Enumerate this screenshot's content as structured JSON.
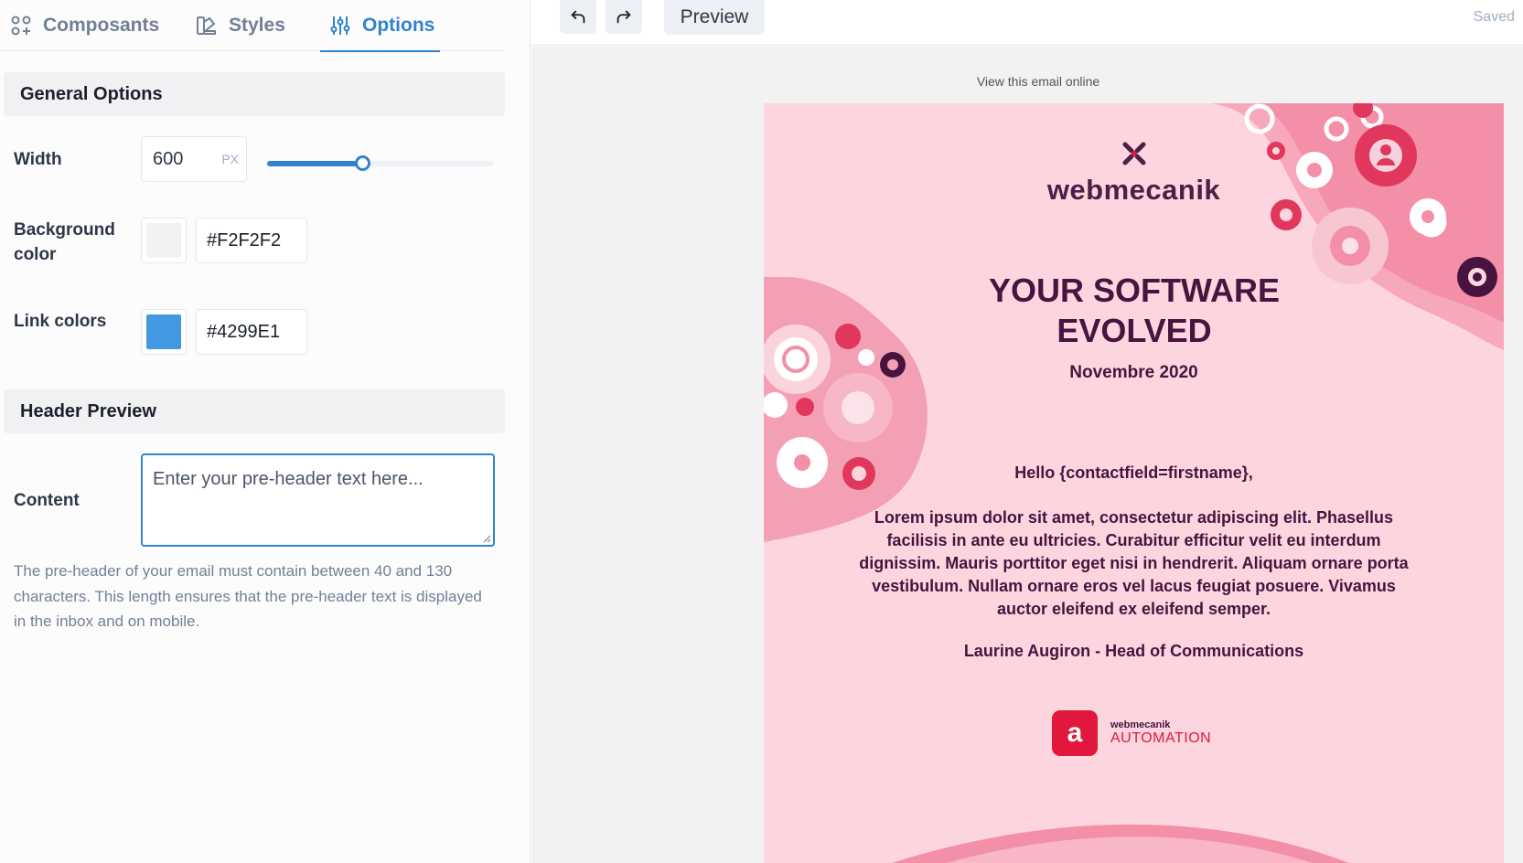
{
  "tabs": [
    {
      "label": "Composants",
      "icon": "components-icon"
    },
    {
      "label": "Styles",
      "icon": "styles-icon"
    },
    {
      "label": "Options",
      "icon": "sliders-icon",
      "active": true
    }
  ],
  "general_options": {
    "title": "General Options",
    "width": {
      "label": "Width",
      "value": "600",
      "unit": "PX",
      "slider_fraction": 0.42
    },
    "background": {
      "label": "Background color",
      "value": "#F2F2F2",
      "swatch": "#F2F2F2"
    },
    "links": {
      "label": "Link colors",
      "value": "#4299E1",
      "swatch": "#4299E1"
    }
  },
  "header_preview": {
    "title": "Header Preview",
    "content_label": "Content",
    "placeholder": "Enter your pre-header text here...",
    "helper": "The pre-header of your email must contain between 40 and 130 characters. This length ensures that the pre-header text is displayed in the inbox and on mobile."
  },
  "toolbar": {
    "undo_icon": "undo-icon",
    "redo_icon": "redo-icon",
    "preview_label": "Preview",
    "status": "Saved"
  },
  "email": {
    "view_online": "View this email online",
    "brand": "webmecanik",
    "headline": "YOUR SOFTWARE EVOLVED",
    "date": "Novembre 2020",
    "greeting": "Hello {contactfield=firstname},",
    "body": "Lorem ipsum dolor sit amet, consectetur adipiscing elit. Phasellus facilisis in ante eu ultricies. Curabitur efficitur velit eu interdum dignissim. Mauris porttitor eget nisi in hendrerit. Aliquam ornare porta vestibulum. Nullam ornare eros vel lacus feugiat posuere. Vivamus auctor eleifend ex eleifend semper.",
    "signature": "Laurine Augiron - Head of Communications",
    "footer_brand": "webmecanik",
    "footer_product": "AUTOMATION",
    "footer_badge_letter": "a"
  },
  "colors": {
    "accent": "#3182CE",
    "email_bg": "#FDD5DE",
    "email_text": "#48133F",
    "brand_red": "#E2173E"
  }
}
